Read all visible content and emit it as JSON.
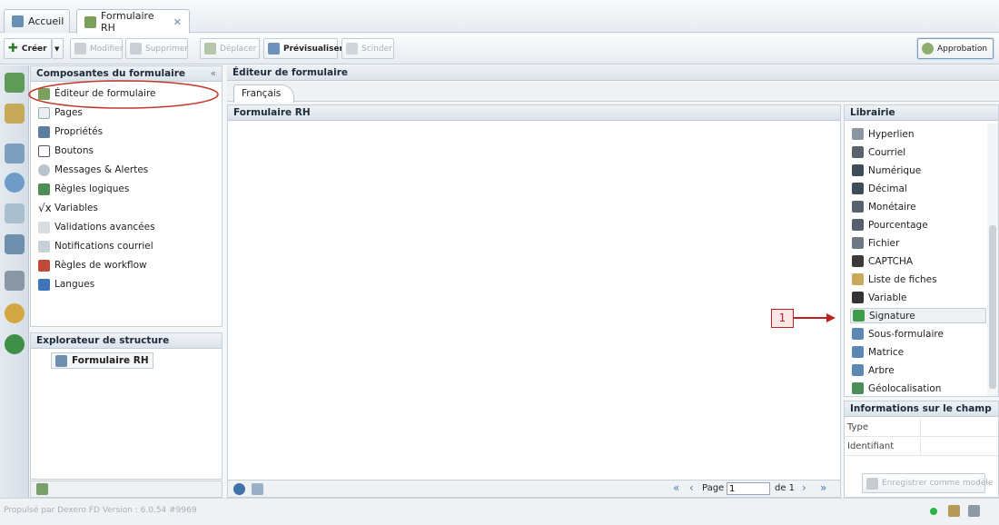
{
  "tabs": [
    {
      "label": "Accueil",
      "icon": "home-icon"
    },
    {
      "label": "Formulaire RH",
      "icon": "form-edit-icon",
      "close": "✕"
    }
  ],
  "toolbar": {
    "create": "Créer",
    "modify": "Modifier",
    "delete": "Supprimer",
    "move": "Déplacer",
    "preview": "Prévisualiser",
    "split": "Scinder",
    "approval": "Approbation"
  },
  "components": {
    "title": "Composantes du formulaire",
    "collapse": "«",
    "items": [
      "Éditeur de formulaire",
      "Pages",
      "Propriétés",
      "Boutons",
      "Messages & Alertes",
      "Règles logiques",
      "Variables",
      "Validations avancées",
      "Notifications courriel",
      "Règles de workflow",
      "Langues"
    ]
  },
  "explorer": {
    "title": "Explorateur de structure",
    "node": "Formulaire RH"
  },
  "editor": {
    "title": "Éditeur de formulaire",
    "lang_tab": "Français",
    "form_title": "Formulaire RH"
  },
  "pager": {
    "page_label": "Page",
    "page_value": "1",
    "of_label": "de 1"
  },
  "library": {
    "title": "Librairie",
    "items": [
      "Hyperlien",
      "Courriel",
      "Numérique",
      "Décimal",
      "Monétaire",
      "Pourcentage",
      "Fichier",
      "CAPTCHA",
      "Liste de fiches",
      "Variable",
      "Signature",
      "Sous-formulaire",
      "Matrice",
      "Arbre",
      "Géolocalisation"
    ],
    "selected_index": 10
  },
  "field_info": {
    "title": "Informations sur le champ",
    "rows": [
      "Type",
      "Identifiant"
    ],
    "save_template": "Enregistrer comme modèle"
  },
  "callout": {
    "number": "1"
  },
  "status": {
    "version": "Propulsé par Dexero FD Version : 6.0.54 #9969"
  },
  "colors": {
    "accent_red": "#c0392b",
    "panel_header": "#dbe3ea",
    "status_green": "#2bb34a"
  }
}
